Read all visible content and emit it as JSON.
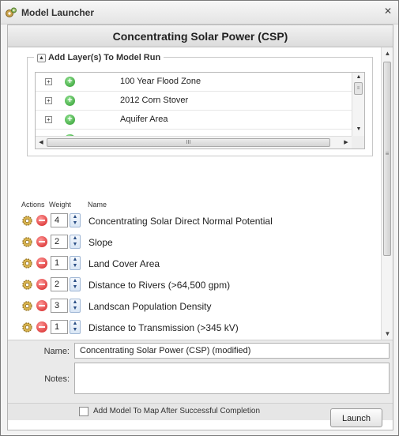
{
  "window": {
    "title": "Model Launcher",
    "close_label": "✕"
  },
  "header": {
    "title": "Concentrating Solar Power (CSP)"
  },
  "layers_section": {
    "legend": "Add Layer(s) To Model Run",
    "toggle_glyph": "▲",
    "items": [
      {
        "label": "100 Year Flood Zone"
      },
      {
        "label": "2012 Corn Stover"
      },
      {
        "label": "Aquifer Area"
      }
    ],
    "hscroll_grip": "III"
  },
  "parameters": {
    "headers": {
      "actions": "Actions",
      "weight": "Weight",
      "name": "Name"
    },
    "rows": [
      {
        "weight": "4",
        "name": "Concentrating Solar Direct Normal Potential"
      },
      {
        "weight": "2",
        "name": "Slope"
      },
      {
        "weight": "1",
        "name": "Land Cover Area"
      },
      {
        "weight": "2",
        "name": "Distance to Rivers (>64,500 gpm)"
      },
      {
        "weight": "3",
        "name": "Landscan Population Density"
      },
      {
        "weight": "1",
        "name": "Distance to Transmission (>345 kV)"
      }
    ]
  },
  "form": {
    "name_label": "Name:",
    "name_value": "Concentrating Solar Power (CSP) (modified)",
    "notes_label": "Notes:",
    "notes_value": "",
    "add_to_map_label": "Add Model To Map After Successful Completion",
    "add_to_map_checked": false
  },
  "actions": {
    "launch_label": "Launch"
  }
}
